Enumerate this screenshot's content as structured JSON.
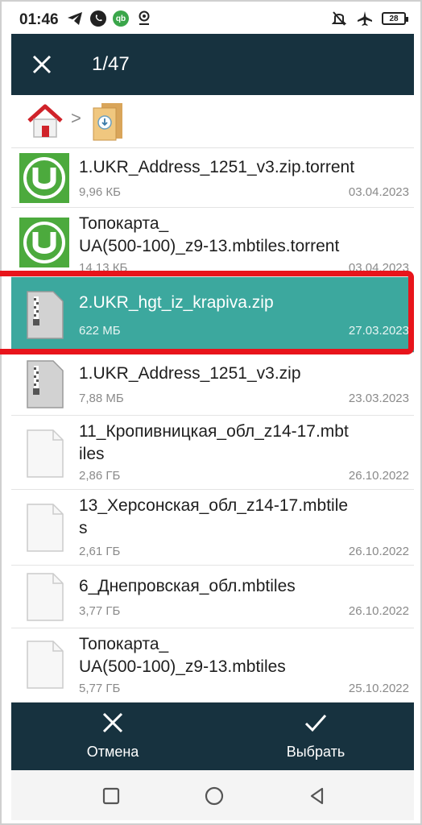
{
  "status_bar": {
    "time": "01:46",
    "battery": "28",
    "left_icons": [
      "telegram-icon",
      "viber-icon",
      "qb-icon",
      "location-icon"
    ],
    "right_icons": [
      "bell-muted-icon",
      "airplane-icon",
      "battery-icon"
    ]
  },
  "app_bar": {
    "title": "1/47",
    "close_icon": "close-icon"
  },
  "breadcrumb": {
    "separator": ">",
    "items": [
      "home-icon",
      "download-folder-icon"
    ]
  },
  "files": [
    {
      "name_lines": [
        "1.UKR_Address_1251_v3.zip.torrent"
      ],
      "size": "9,96 КБ",
      "date": "03.04.2023",
      "icon": "utorrent-icon",
      "selected": false
    },
    {
      "name_lines": [
        "Топокарта_",
        "UA(500-100)_z9-13.mbtiles.torrent"
      ],
      "size": "14,13 КБ",
      "date": "03.04.2023",
      "icon": "utorrent-icon",
      "selected": false
    },
    {
      "name_lines": [
        "2.UKR_hgt_iz_krapiva.zip"
      ],
      "size": "622 МБ",
      "date": "27.03.2023",
      "icon": "zip-file-icon",
      "selected": true
    },
    {
      "name_lines": [
        "1.UKR_Address_1251_v3.zip"
      ],
      "size": "7,88 МБ",
      "date": "23.03.2023",
      "icon": "zip-file-icon",
      "selected": false
    },
    {
      "name_lines": [
        "11_Кропивницкая_обл_z14-17.mbt",
        "iles"
      ],
      "size": "2,86 ГБ",
      "date": "26.10.2022",
      "icon": "blank-file-icon",
      "selected": false
    },
    {
      "name_lines": [
        "13_Херсонская_обл_z14-17.mbtile",
        "s"
      ],
      "size": "2,61 ГБ",
      "date": "26.10.2022",
      "icon": "blank-file-icon",
      "selected": false
    },
    {
      "name_lines": [
        "6_Днепровская_обл.mbtiles"
      ],
      "size": "3,77 ГБ",
      "date": "26.10.2022",
      "icon": "blank-file-icon",
      "selected": false
    },
    {
      "name_lines": [
        "Топокарта_",
        "UA(500-100)_z9-13.mbtiles"
      ],
      "size": "5,77 ГБ",
      "date": "25.10.2022",
      "icon": "blank-file-icon",
      "selected": false
    }
  ],
  "actions": {
    "cancel_label": "Отмена",
    "select_label": "Выбрать"
  },
  "nav": [
    "recents-icon",
    "home-circle-icon",
    "back-triangle-icon"
  ],
  "colors": {
    "app_bar": "#17323f",
    "selected_row": "#3ca89e",
    "highlight_border": "#e8141b"
  }
}
